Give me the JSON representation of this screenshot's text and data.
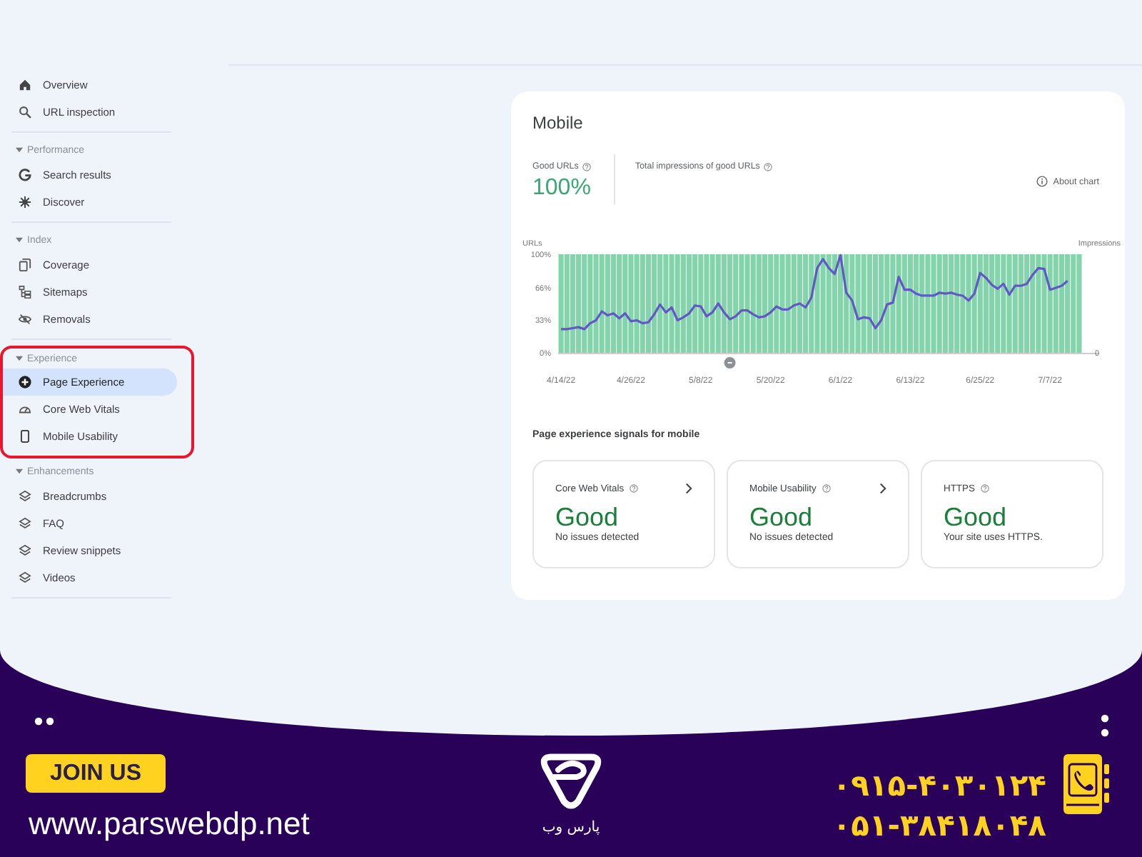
{
  "sidebar": {
    "top_items": [
      {
        "label": "Overview",
        "selected": false
      },
      {
        "label": "URL inspection",
        "selected": false
      }
    ],
    "sections": [
      {
        "title": "Performance",
        "expanded": true,
        "highlighted": false,
        "items": [
          {
            "label": "Search results",
            "selected": false
          },
          {
            "label": "Discover",
            "selected": false
          }
        ]
      },
      {
        "title": "Index",
        "expanded": true,
        "highlighted": false,
        "items": [
          {
            "label": "Coverage",
            "selected": false
          },
          {
            "label": "Sitemaps",
            "selected": false
          },
          {
            "label": "Removals",
            "selected": false
          }
        ]
      },
      {
        "title": "Experience",
        "expanded": true,
        "highlighted": true,
        "items": [
          {
            "label": "Page Experience",
            "selected": true
          },
          {
            "label": "Core Web Vitals",
            "selected": false
          },
          {
            "label": "Mobile Usability",
            "selected": false
          }
        ]
      },
      {
        "title": "Enhancements",
        "expanded": true,
        "highlighted": false,
        "items": [
          {
            "label": "Breadcrumbs",
            "selected": false
          },
          {
            "label": "FAQ",
            "selected": false
          },
          {
            "label": "Review snippets",
            "selected": false
          },
          {
            "label": "Videos",
            "selected": false
          }
        ]
      }
    ]
  },
  "report": {
    "title": "Mobile",
    "metrics": [
      {
        "label": "Good URLs",
        "value": "100%"
      },
      {
        "label": "Total impressions of good URLs"
      }
    ],
    "about_chart": "About chart",
    "chart": {
      "right_axis_label": "Impressions",
      "right_axis_tick": "0",
      "chart_data": {
        "type": "bar",
        "ylabel": "URLs",
        "ylim": [
          0,
          100
        ],
        "yticks": [
          {
            "value": 0,
            "label": "0%"
          },
          {
            "value": 33,
            "label": "33%"
          },
          {
            "value": 66,
            "label": "66%"
          },
          {
            "value": 100,
            "label": "100%"
          }
        ],
        "categories": [
          "4/14/22",
          null,
          null,
          null,
          null,
          null,
          null,
          null,
          null,
          null,
          null,
          null,
          "4/26/22",
          null,
          null,
          null,
          null,
          null,
          null,
          null,
          null,
          null,
          null,
          null,
          "5/8/22",
          null,
          null,
          null,
          null,
          null,
          null,
          null,
          null,
          null,
          null,
          null,
          "5/20/22",
          null,
          null,
          null,
          null,
          null,
          null,
          null,
          null,
          null,
          null,
          null,
          "6/1/22",
          null,
          null,
          null,
          null,
          null,
          null,
          null,
          null,
          null,
          null,
          null,
          "6/13/22",
          null,
          null,
          null,
          null,
          null,
          null,
          null,
          null,
          null,
          null,
          null,
          "6/25/22",
          null,
          null,
          null,
          null,
          null,
          null,
          null,
          null,
          null,
          null,
          null,
          "7/7/22",
          null,
          null,
          null,
          null,
          null
        ],
        "series": [
          {
            "color": "#84d4ab",
            "values": [
              100,
              100,
              100,
              100,
              100,
              100,
              100,
              100,
              100,
              100,
              100,
              100,
              100,
              100,
              100,
              100,
              100,
              100,
              100,
              100,
              100,
              100,
              100,
              100,
              100,
              100,
              100,
              100,
              100,
              100,
              100,
              100,
              100,
              100,
              100,
              100,
              100,
              100,
              100,
              100,
              100,
              100,
              100,
              100,
              100,
              100,
              100,
              100,
              100,
              100,
              100,
              100,
              100,
              100,
              100,
              100,
              100,
              100,
              100,
              100,
              100,
              100,
              100,
              100,
              100,
              100,
              100,
              100,
              100,
              100,
              100,
              100,
              100,
              100,
              100,
              100,
              100,
              100,
              100,
              100,
              100,
              100,
              100,
              100,
              100,
              100,
              100,
              100,
              100,
              100
            ]
          },
          {
            "type": "line",
            "color": "#6157c6",
            "values": [
              24,
              24,
              25,
              26,
              24,
              30,
              33,
              42,
              38,
              40,
              35,
              40,
              32,
              33,
              30,
              31,
              39,
              49,
              41,
              46,
              33,
              36,
              40,
              48,
              47,
              37,
              41,
              50,
              41,
              34,
              37,
              43,
              43,
              39,
              36,
              37,
              41,
              47,
              44,
              44,
              48,
              50,
              46,
              56,
              86,
              95,
              86,
              80,
              99,
              61,
              53,
              34,
              36,
              35,
              25,
              33,
              49,
              51,
              77,
              64,
              64,
              60,
              58,
              58,
              58,
              61,
              60,
              61,
              59,
              58,
              53,
              60,
              81,
              76,
              69,
              65,
              70,
              59,
              68,
              68,
              70,
              79,
              86,
              85,
              64,
              66,
              68,
              73,
              null,
              null
            ]
          }
        ]
      }
    }
  },
  "signals": {
    "title": "Page experience signals for mobile",
    "cards": [
      {
        "title": "Core Web Vitals",
        "status": "Good",
        "detail": "No issues detected",
        "link": true
      },
      {
        "title": "Mobile Usability",
        "status": "Good",
        "detail": "No issues detected",
        "link": true
      },
      {
        "title": "HTTPS",
        "status": "Good",
        "detail": "Your site uses HTTPS.",
        "link": false
      }
    ]
  },
  "footer": {
    "join_button": "JOIN US",
    "website": "www.parswebdp.net",
    "logo_text": "پارس وب",
    "phones": [
      "۰۹۱۵-۴۰۳۰۱۲۴",
      "۰۵۱-۳۸۴۱۸۰۴۸"
    ]
  }
}
